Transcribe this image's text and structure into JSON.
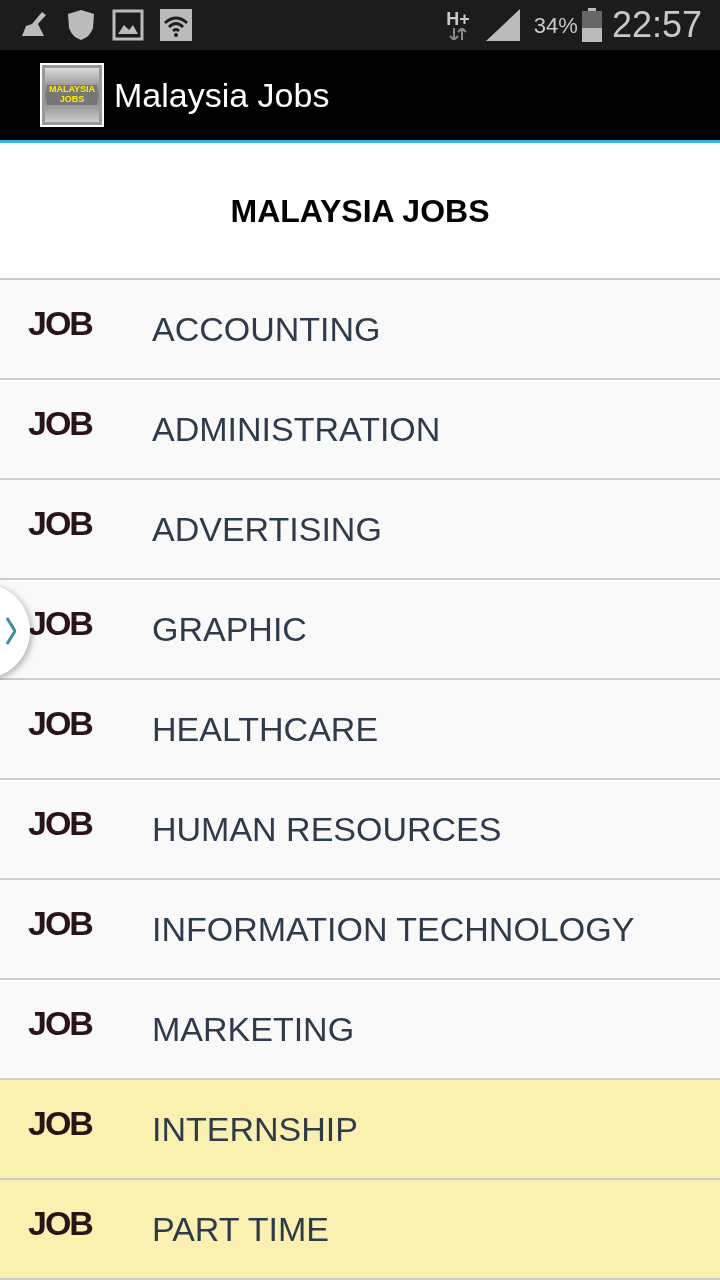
{
  "status_bar": {
    "network": "H+",
    "battery": "34%",
    "time": "22:57"
  },
  "app_bar": {
    "logo_text": "MALAYSIA JOBS",
    "title": "Malaysia Jobs"
  },
  "header": {
    "title": "MALAYSIA JOBS"
  },
  "categories": [
    {
      "badge": "JOB",
      "label": "ACCOUNTING",
      "highlighted": false
    },
    {
      "badge": "JOB",
      "label": "ADMINISTRATION",
      "highlighted": false
    },
    {
      "badge": "JOB",
      "label": "ADVERTISING",
      "highlighted": false
    },
    {
      "badge": "JOB",
      "label": "GRAPHIC",
      "highlighted": false
    },
    {
      "badge": "JOB",
      "label": "HEALTHCARE",
      "highlighted": false
    },
    {
      "badge": "JOB",
      "label": "HUMAN RESOURCES",
      "highlighted": false
    },
    {
      "badge": "JOB",
      "label": "INFORMATION TECHNOLOGY",
      "highlighted": false
    },
    {
      "badge": "JOB",
      "label": "MARKETING",
      "highlighted": false
    },
    {
      "badge": "JOB",
      "label": "INTERNSHIP",
      "highlighted": true
    },
    {
      "badge": "JOB",
      "label": "PART TIME",
      "highlighted": true
    }
  ]
}
